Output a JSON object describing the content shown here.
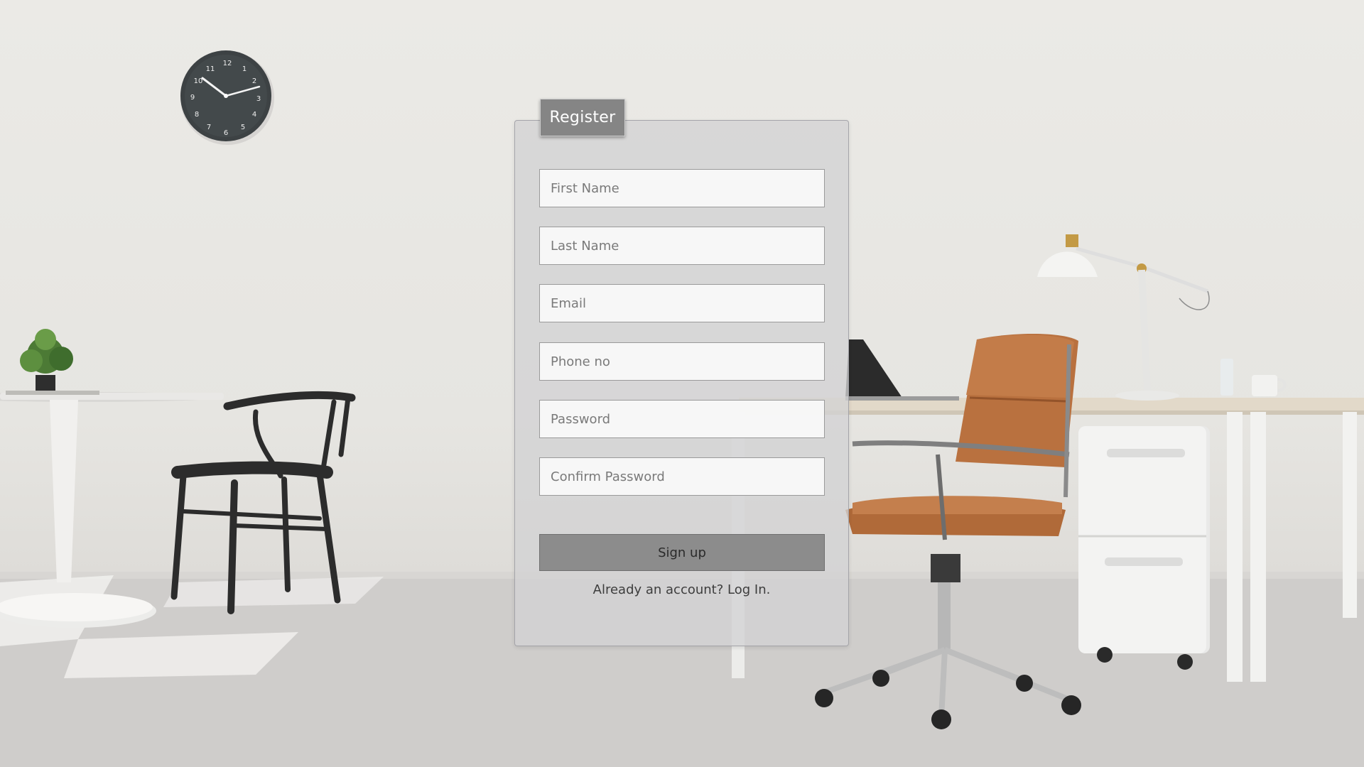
{
  "form": {
    "title": "Register",
    "fields": [
      {
        "placeholder": "First Name",
        "value": ""
      },
      {
        "placeholder": "Last Name",
        "value": ""
      },
      {
        "placeholder": "Email",
        "value": ""
      },
      {
        "placeholder": "Phone no",
        "value": ""
      },
      {
        "placeholder": "Password",
        "value": ""
      },
      {
        "placeholder": "Confirm Password",
        "value": ""
      }
    ],
    "submit_label": "Sign up",
    "footer_prefix": "Already an account?",
    "footer_link": "Log In."
  },
  "background": {
    "clock_numerals": [
      "12",
      "1",
      "2",
      "3",
      "4",
      "5",
      "6",
      "7",
      "8",
      "9",
      "10",
      "11"
    ]
  },
  "colors": {
    "tab": "#858585",
    "button": "#8c8c8c",
    "chair_leather": "#b9713f"
  }
}
